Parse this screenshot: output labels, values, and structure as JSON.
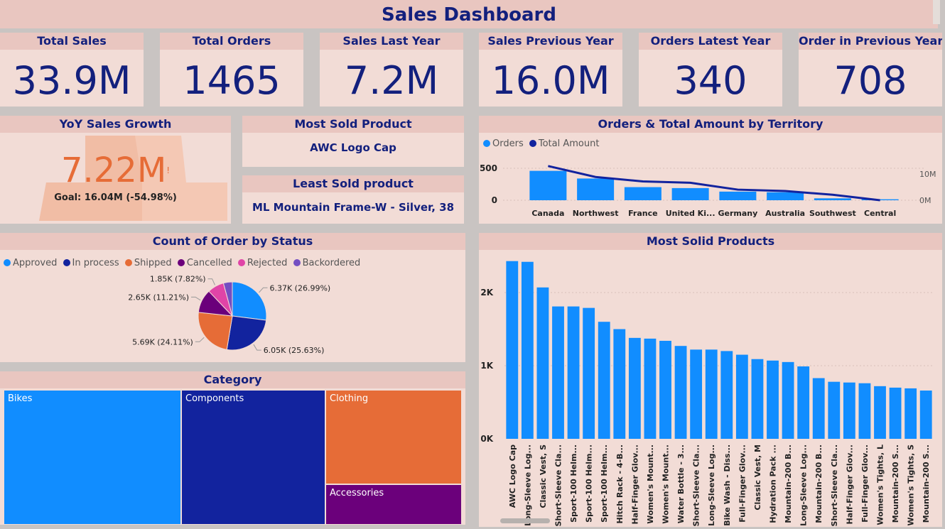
{
  "title": "Sales Dashboard",
  "kpis": [
    {
      "label": "Total Sales",
      "value": "33.9M"
    },
    {
      "label": "Total Orders",
      "value": "1465"
    },
    {
      "label": "Sales Last Year",
      "value": "7.2M"
    },
    {
      "label": "Sales Previous Year",
      "value": "16.0M"
    },
    {
      "label": "Orders Latest Year",
      "value": "340"
    },
    {
      "label": "Order in Previous Year",
      "value": "708"
    }
  ],
  "yoy": {
    "title": "YoY Sales Growth",
    "value": "7.22M",
    "warning": "!",
    "goal": "Goal: 16.04M (-54.98%)",
    "progress": 0.45
  },
  "most_sold": {
    "title": "Most Sold Product",
    "value": "AWC Logo Cap"
  },
  "least_sold": {
    "title": "Least Sold product",
    "value": "ML Mountain Frame-W - Silver, 38"
  },
  "colors": {
    "accent_blue": "#118dff",
    "dark_blue": "#12239e",
    "orange": "#e66c37",
    "purple": "#6b007b",
    "pink": "#e044a7",
    "dark_purple": "#744ec2",
    "title_blue": "#13207d"
  },
  "chart_data": [
    {
      "type": "bar+line",
      "title": "Orders & Total Amount by Territory",
      "categories": [
        "Canada",
        "Northwest",
        "France",
        "United Ki...",
        "Germany",
        "Australia",
        "Southwest",
        "Central"
      ],
      "series": [
        {
          "name": "Orders",
          "type": "bar",
          "values": [
            460,
            340,
            205,
            190,
            135,
            125,
            30,
            15
          ]
        },
        {
          "name": "Total Amount",
          "type": "line",
          "values": [
            10000000,
            6800000,
            5500000,
            5100000,
            3100000,
            2700000,
            1600000,
            0
          ]
        }
      ],
      "y_ticks_left": [
        "500",
        "0"
      ],
      "y_ticks_right": [
        "10M",
        "0M"
      ],
      "ylim_left": [
        0,
        500
      ],
      "ylim_right": [
        0,
        11000000
      ],
      "legend_position": "top-left",
      "grid": true
    },
    {
      "type": "pie",
      "title": "Count of Order by Status",
      "legend": [
        "Approved",
        "In process",
        "Shipped",
        "Cancelled",
        "Rejected",
        "Backordered"
      ],
      "slices": [
        {
          "name": "Approved",
          "value": 6370,
          "label": "6.37K (26.99%)",
          "color": "#118dff"
        },
        {
          "name": "In process",
          "value": 6050,
          "label": "6.05K (25.63%)",
          "color": "#12239e"
        },
        {
          "name": "Shipped",
          "value": 5690,
          "label": "5.69K (24.11%)",
          "color": "#e66c37"
        },
        {
          "name": "Cancelled",
          "value": 2650,
          "label": "2.65K (11.21%)",
          "color": "#6b007b"
        },
        {
          "name": "Rejected",
          "value": 1850,
          "label": "1.85K (7.82%)",
          "color": "#e044a7"
        },
        {
          "name": "Backordered",
          "value": 1000,
          "label": "",
          "color": "#744ec2"
        }
      ],
      "legend_position": "top-left"
    },
    {
      "type": "treemap",
      "title": "Category",
      "items": [
        {
          "name": "Bikes",
          "color": "#118dff"
        },
        {
          "name": "Components",
          "color": "#12239e"
        },
        {
          "name": "Clothing",
          "color": "#e66c37"
        },
        {
          "name": "Accessories",
          "color": "#6b007b"
        }
      ]
    },
    {
      "type": "bar",
      "title": "Most Solid Products",
      "categories": [
        "AWC Logo Cap",
        "Long-Sleeve Log...",
        "Classic Vest, S",
        "Short-Sleeve Cla...",
        "Sport-100 Helm...",
        "Sport-100 Helm...",
        "Sport-100 Helm...",
        "Hitch Rack - 4-B...",
        "Half-Finger Glov...",
        "Women's Mount...",
        "Women's Mount...",
        "Water Bottle - 3...",
        "Short-Sleeve Cla...",
        "Long-Sleeve Log...",
        "Bike Wash - Diss...",
        "Full-Finger Glov...",
        "Classic Vest, M",
        "Hydration Pack ...",
        "Mountain-200 B...",
        "Long-Sleeve Log...",
        "Mountain-200 B...",
        "Short-Sleeve Cla...",
        "Half-Finger Glov...",
        "Full-Finger Glov...",
        "Women's Tights, L",
        "Mountain-200 S...",
        "Women's Tights, S",
        "Mountain-200 S..."
      ],
      "values": [
        2430,
        2420,
        2070,
        1810,
        1810,
        1790,
        1600,
        1500,
        1380,
        1370,
        1340,
        1270,
        1220,
        1220,
        1200,
        1150,
        1090,
        1070,
        1050,
        990,
        830,
        780,
        770,
        760,
        720,
        700,
        690,
        660
      ],
      "y_ticks": [
        "2K",
        "1K",
        "0K"
      ],
      "ylim": [
        0,
        2450
      ],
      "grid": true
    }
  ]
}
